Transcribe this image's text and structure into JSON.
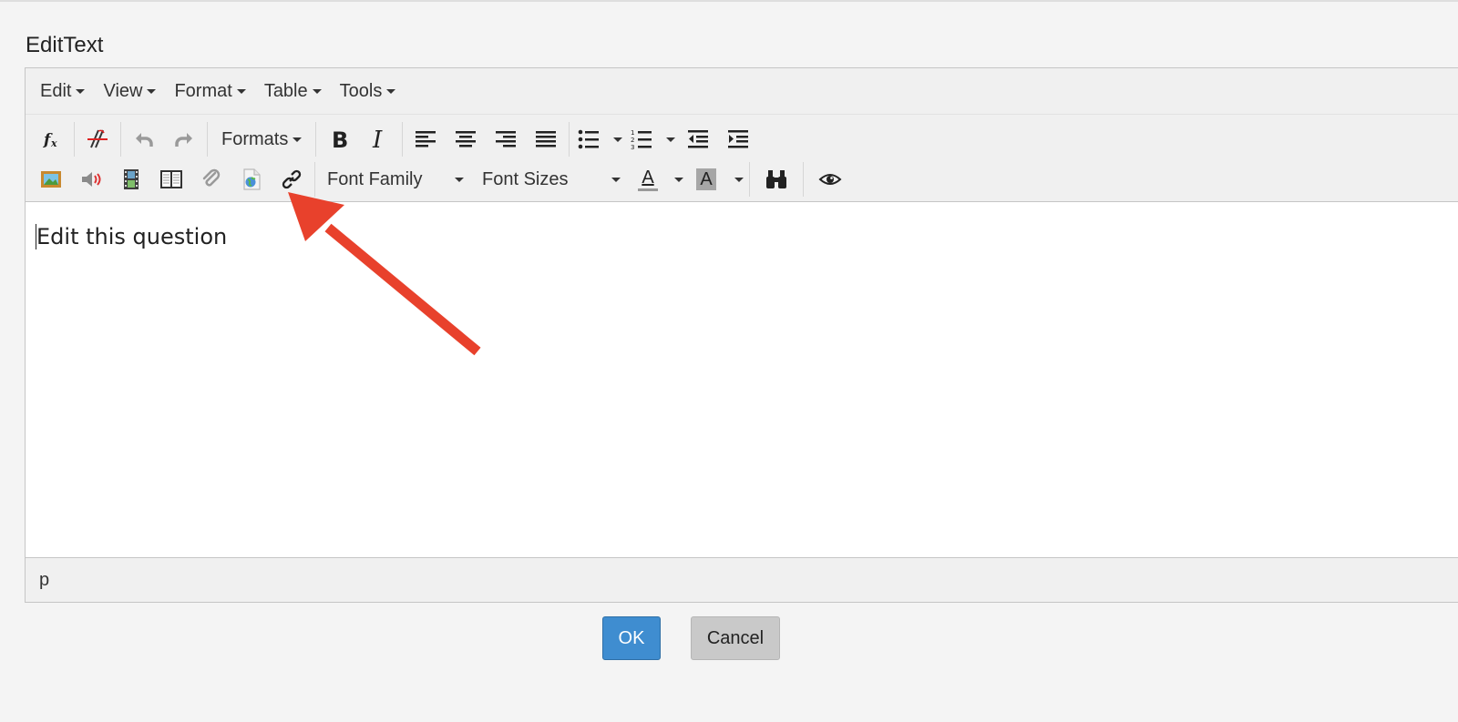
{
  "dialog": {
    "title": "EditText"
  },
  "menubar": {
    "items": [
      {
        "label": "Edit"
      },
      {
        "label": "View"
      },
      {
        "label": "Format"
      },
      {
        "label": "Table"
      },
      {
        "label": "Tools"
      }
    ]
  },
  "toolbar": {
    "formats_label": "Formats",
    "font_family_label": "Font Family",
    "font_sizes_label": "Font Sizes",
    "text_color_glyph": "A",
    "bg_color_glyph": "A",
    "icons": {
      "row1": [
        "formula-icon",
        "strikethrough-format-icon",
        "undo-icon",
        "redo-icon",
        "bold-icon",
        "italic-icon",
        "align-left-icon",
        "align-center-icon",
        "align-right-icon",
        "justify-icon",
        "bullet-list-icon",
        "numbered-list-icon",
        "outdent-icon",
        "indent-icon"
      ],
      "row2": [
        "image-icon",
        "audio-icon",
        "video-icon",
        "book-icon",
        "attachment-icon",
        "web-resource-icon",
        "link-icon",
        "binoculars-icon",
        "preview-eye-icon"
      ]
    }
  },
  "content": {
    "text": "Edit this question"
  },
  "statusbar": {
    "path": "p"
  },
  "buttons": {
    "ok": "OK",
    "cancel": "Cancel"
  },
  "colors": {
    "primary_button": "#3f8dd0",
    "cancel_button": "#c9c9c9",
    "annotation_arrow": "#e8412c",
    "background": "#f4f4f4"
  }
}
